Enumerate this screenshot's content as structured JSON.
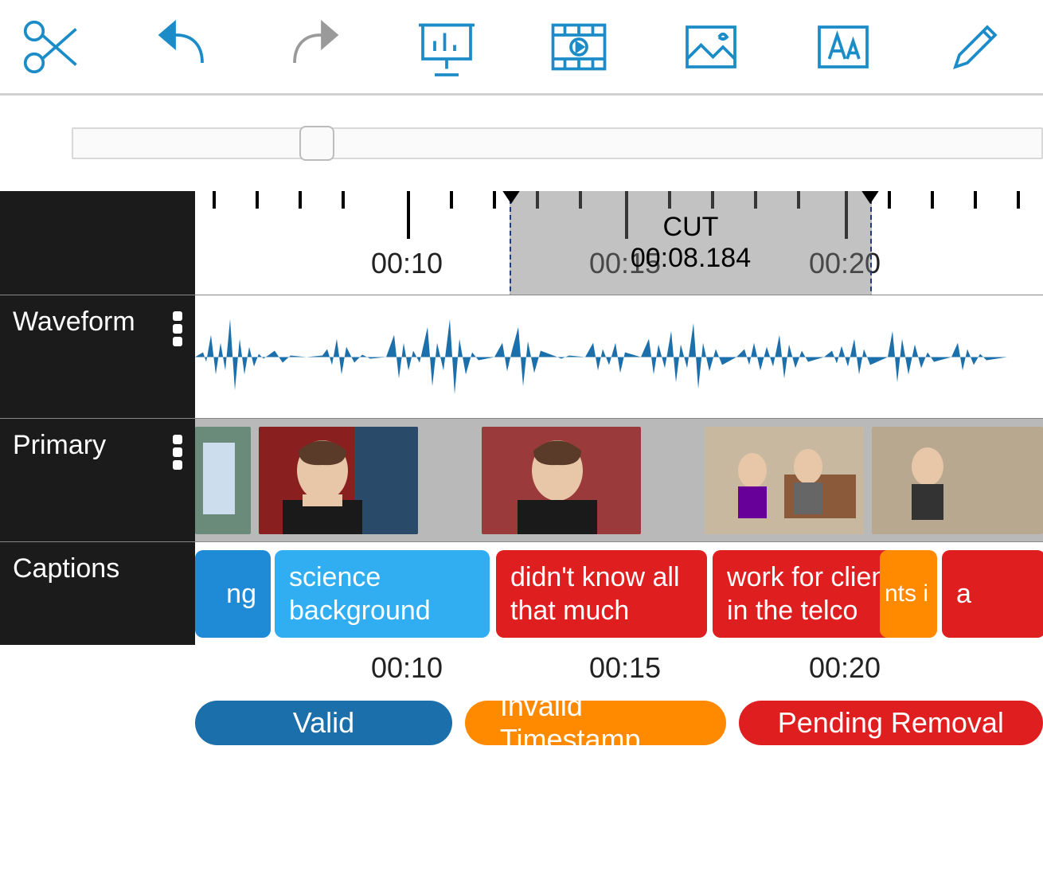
{
  "colors": {
    "brand": "#1b8cc7",
    "gray": "#9a9a9a",
    "valid": "#1b6fab",
    "invalid": "#ff8a00",
    "pending": "#df1f1f",
    "caption_blue": "#1f8bd6",
    "caption_lightblue": "#31aef2",
    "caption_red": "#df1f1f"
  },
  "toolbar": {
    "icons": [
      "scissors",
      "undo",
      "redo",
      "presentation",
      "video",
      "image",
      "text",
      "pencil"
    ]
  },
  "cut": {
    "label": "CUT",
    "duration": "00:08.184"
  },
  "tracks": {
    "waveform_label": "Waveform",
    "primary_label": "Primary",
    "captions_label": "Captions"
  },
  "ruler": {
    "labels": [
      "00:10",
      "00:15",
      "00:20"
    ]
  },
  "captions": [
    {
      "text": "ng",
      "style": "blue"
    },
    {
      "text": "science background",
      "style": "lblue"
    },
    {
      "text": "didn't know all that much",
      "style": "red"
    },
    {
      "text": "work for clients in the telco",
      "style": "red"
    },
    {
      "text": "nts i",
      "style": "orange"
    },
    {
      "text": "a",
      "style": "red"
    }
  ],
  "footer_times": [
    "00:10",
    "00:15",
    "00:20"
  ],
  "legend": {
    "valid": "Valid",
    "invalid": "Invalid Timestamp",
    "pending": "Pending Removal"
  }
}
